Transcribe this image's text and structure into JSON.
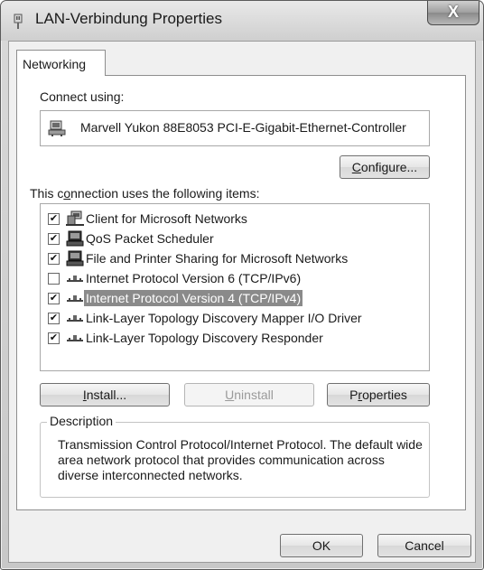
{
  "window": {
    "title": "LAN-Verbindung Properties",
    "close_label": "X"
  },
  "tabs": [
    {
      "label": "Networking",
      "selected": true
    }
  ],
  "connect_using": {
    "label": "Connect using:",
    "adapter_name": "Marvell Yukon 88E8053 PCI-E-Gigabit-Ethernet-Controller",
    "adapter_icon": "network-adapter-icon"
  },
  "configure_button": {
    "prefix": "",
    "accel": "C",
    "suffix": "onfigure..."
  },
  "items_label": {
    "prefix": "This c",
    "accel": "o",
    "suffix": "nnection uses the following items:"
  },
  "items": [
    {
      "label": "Client for Microsoft Networks",
      "checked": true,
      "icon": "client-network-icon",
      "selected": false
    },
    {
      "label": "QoS Packet Scheduler",
      "checked": true,
      "icon": "service-icon",
      "selected": false
    },
    {
      "label": "File and Printer Sharing for Microsoft Networks",
      "checked": true,
      "icon": "service-icon",
      "selected": false
    },
    {
      "label": "Internet Protocol Version 6 (TCP/IPv6)",
      "checked": false,
      "icon": "protocol-icon",
      "selected": false
    },
    {
      "label": "Internet Protocol Version 4 (TCP/IPv4)",
      "checked": true,
      "icon": "protocol-icon",
      "selected": true
    },
    {
      "label": "Link-Layer Topology Discovery Mapper I/O Driver",
      "checked": true,
      "icon": "protocol-icon",
      "selected": false
    },
    {
      "label": "Link-Layer Topology Discovery Responder",
      "checked": true,
      "icon": "protocol-icon",
      "selected": false
    }
  ],
  "buttons": {
    "install": {
      "prefix": "",
      "accel": "I",
      "suffix": "nstall...",
      "enabled": true
    },
    "uninstall": {
      "prefix": "",
      "accel": "U",
      "suffix": "ninstall",
      "enabled": false
    },
    "properties": {
      "prefix": "P",
      "accel": "r",
      "suffix": "operties",
      "enabled": true
    }
  },
  "description": {
    "legend": "Description",
    "text": "Transmission Control Protocol/Internet Protocol. The default wide area network protocol that provides communication across diverse interconnected networks."
  },
  "footer": {
    "ok_label": "OK",
    "cancel_label": "Cancel"
  },
  "colors": {
    "selection": "#8a8a8a",
    "window_frame": "#d0d0d0"
  }
}
